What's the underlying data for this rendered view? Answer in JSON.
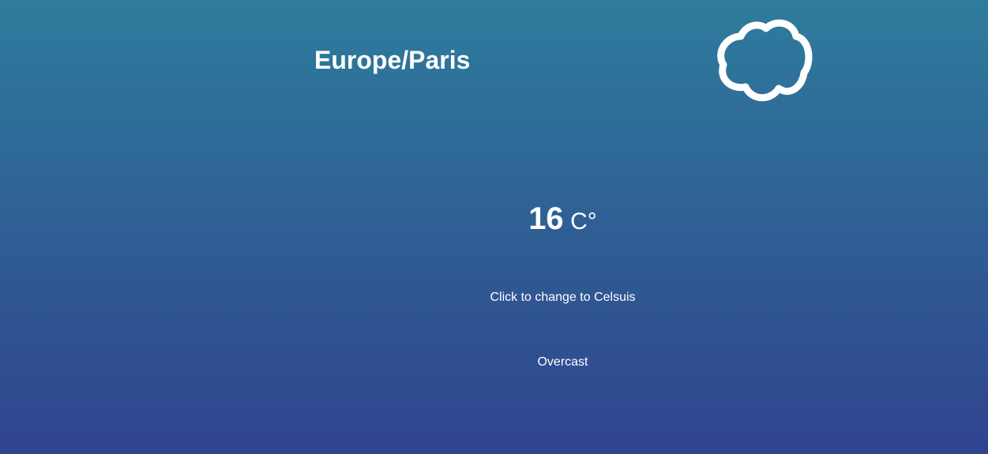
{
  "weather": {
    "location": "Europe/Paris",
    "temperature": "16",
    "unit": "C°",
    "toggle_label": "Click to change to Celsuis",
    "condition": "Overcast",
    "icon": "cloud-icon"
  },
  "colors": {
    "gradient_top": "#2e7c9d",
    "gradient_bottom": "#30438f",
    "text": "#ffffff"
  }
}
